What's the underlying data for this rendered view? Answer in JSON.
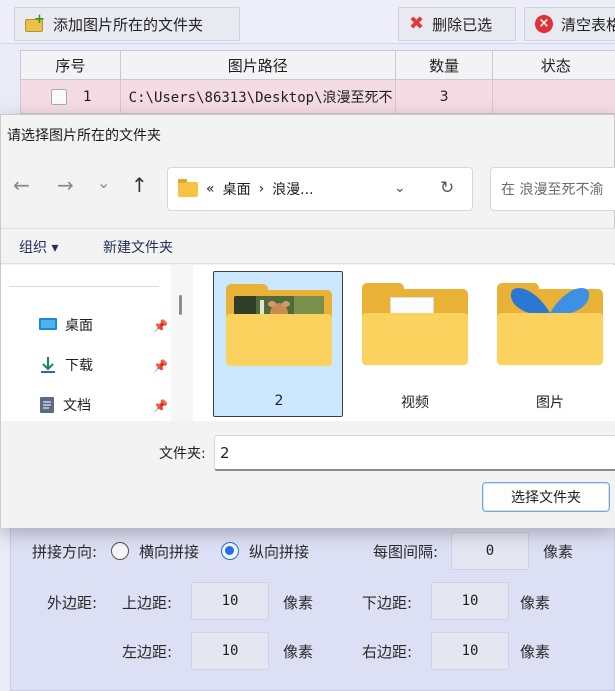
{
  "app": {
    "toolbar": {
      "add_folder_label": "添加图片所在的文件夹",
      "delete_selected_label": "删除已选",
      "clear_table_label": "清空表格"
    },
    "table": {
      "headers": [
        "序号",
        "图片路径",
        "数量",
        "状态"
      ],
      "rows": [
        {
          "index": "1",
          "path": "C:\\Users\\86313\\Desktop\\浪漫至死不",
          "count": "3",
          "status": ""
        }
      ]
    },
    "settings": {
      "direction_label": "拼接方向:",
      "horizontal_label": "横向拼接",
      "vertical_label": "纵向拼接",
      "direction_selected": "纵向拼接",
      "spacing_label": "每图间隔:",
      "spacing_value": "0",
      "spacing_unit": "像素",
      "outer_margin_label": "外边距:",
      "top_label": "上边距:",
      "top_value": "10",
      "top_unit": "像素",
      "bottom_label": "下边距:",
      "bottom_value": "10",
      "bottom_unit": "像素",
      "left_label": "左边距:",
      "left_value": "10",
      "left_unit": "像素",
      "right_label": "右边距:",
      "right_value": "10",
      "right_unit": "像素"
    }
  },
  "dialog": {
    "title": "请选择图片所在的文件夹",
    "nav": {
      "back": "←",
      "forward": "→",
      "recent": "⌄",
      "up": "↑"
    },
    "address": {
      "prefix": "«",
      "crumb1": "桌面",
      "sep": "›",
      "crumb2": "浪漫..."
    },
    "search_placeholder": "在 浪漫至死不渝",
    "commands": {
      "organize": "组织 ▾",
      "new_folder": "新建文件夹"
    },
    "sidebar": [
      {
        "label": "桌面",
        "icon": "desktop-icon"
      },
      {
        "label": "下载",
        "icon": "download-icon"
      },
      {
        "label": "文档",
        "icon": "document-icon"
      }
    ],
    "folders": [
      {
        "label": "2",
        "selected": true
      },
      {
        "label": "视频",
        "selected": false
      },
      {
        "label": "图片",
        "selected": false
      }
    ],
    "folder_field_label": "文件夹:",
    "folder_field_value": "2",
    "select_button": "选择文件夹"
  },
  "colors": {
    "accent": "#1a73e8",
    "row_highlight": "#f5dbe2",
    "selection": "#cce8ff",
    "folder_yellow": "#fcd25f"
  }
}
